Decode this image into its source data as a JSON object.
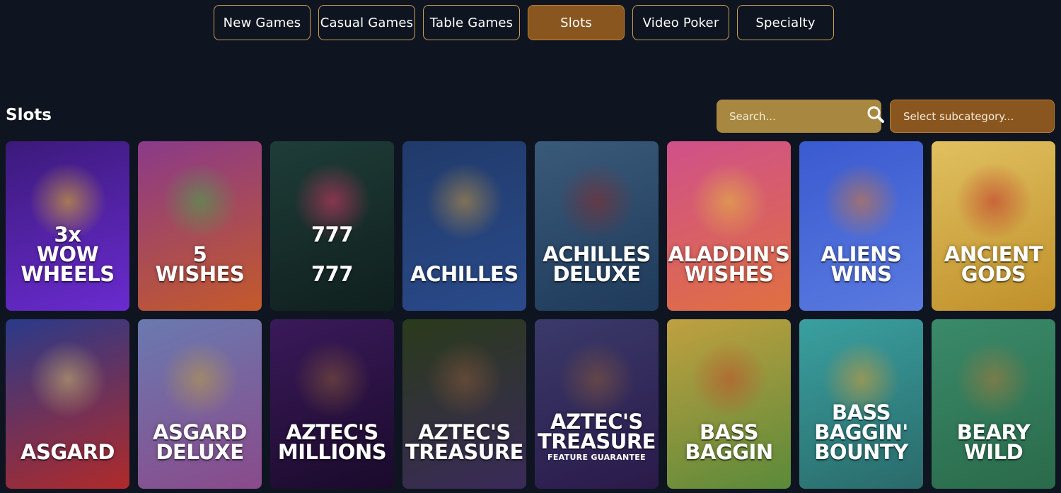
{
  "tabs": [
    {
      "label": "New Games",
      "active": false
    },
    {
      "label": "Casual Games",
      "active": false
    },
    {
      "label": "Table Games",
      "active": false
    },
    {
      "label": "Slots",
      "active": true
    },
    {
      "label": "Video Poker",
      "active": false
    },
    {
      "label": "Specialty",
      "active": false
    }
  ],
  "section": {
    "title": "Slots"
  },
  "search": {
    "placeholder": "Search...",
    "value": ""
  },
  "subcategory": {
    "selected": "Select subcategory..."
  },
  "games": [
    {
      "title": "3x\nWOW\nWHEELS",
      "bg": [
        "#3b1a7a",
        "#6a2bd0"
      ],
      "art": "#f0c020"
    },
    {
      "title": "5\nWISHES",
      "bg": [
        "#8a3a8a",
        "#c45a2a"
      ],
      "art": "#3fae4a"
    },
    {
      "title": "777\n\n777",
      "bg": [
        "#1f3d38",
        "#0f1f1d"
      ],
      "art": "#e23a6a"
    },
    {
      "title": "ACHILLES",
      "bg": [
        "#203a6a",
        "#2a4a8a"
      ],
      "art": "#c99a40"
    },
    {
      "title": "ACHILLES\nDELUXE",
      "bg": [
        "#3a5a7a",
        "#1f3a5a"
      ],
      "art": "#8a2a2a"
    },
    {
      "title": "ALADDIN'S\nWISHES",
      "bg": [
        "#d0508a",
        "#e07040"
      ],
      "art": "#e6c040"
    },
    {
      "title": "ALIENS\nWINS",
      "bg": [
        "#3a5ad0",
        "#5a7ae0"
      ],
      "art": "#e07a2a"
    },
    {
      "title": "ANCIENT\nGODS",
      "bg": [
        "#e0c060",
        "#c0902a"
      ],
      "art": "#c02a2a"
    },
    {
      "title": "ASGARD",
      "bg": [
        "#2a3a8a",
        "#b02a2a"
      ],
      "art": "#d0c070"
    },
    {
      "title": "ASGARD\nDELUXE",
      "bg": [
        "#6a7ab0",
        "#8a4a8a"
      ],
      "art": "#c0a040"
    },
    {
      "title": "AZTEC'S\nMILLIONS",
      "bg": [
        "#3a1a5a",
        "#1a0a2a"
      ],
      "art": "#8a5a3a"
    },
    {
      "title": "AZTEC'S\nTREASURE",
      "bg": [
        "#2a3a1a",
        "#3a2a5a"
      ],
      "art": "#8a5a3a"
    },
    {
      "title": "AZTEC'S\nTREASURE",
      "sub": "FEATURE GUARANTEE",
      "bg": [
        "#3a3a6a",
        "#2a1a4a"
      ],
      "art": "#8a5a3a"
    },
    {
      "title": "BASS\nBAGGIN",
      "bg": [
        "#c0a040",
        "#5a8a3a"
      ],
      "art": "#c04a2a"
    },
    {
      "title": "BASS\nBAGGIN'\nBOUNTY",
      "bg": [
        "#3aa0a0",
        "#2a6a6a"
      ],
      "art": "#e0a030"
    },
    {
      "title": "BEARY\nWILD",
      "bg": [
        "#3a8a6a",
        "#2a6a4a"
      ],
      "art": "#b07a3a"
    }
  ]
}
